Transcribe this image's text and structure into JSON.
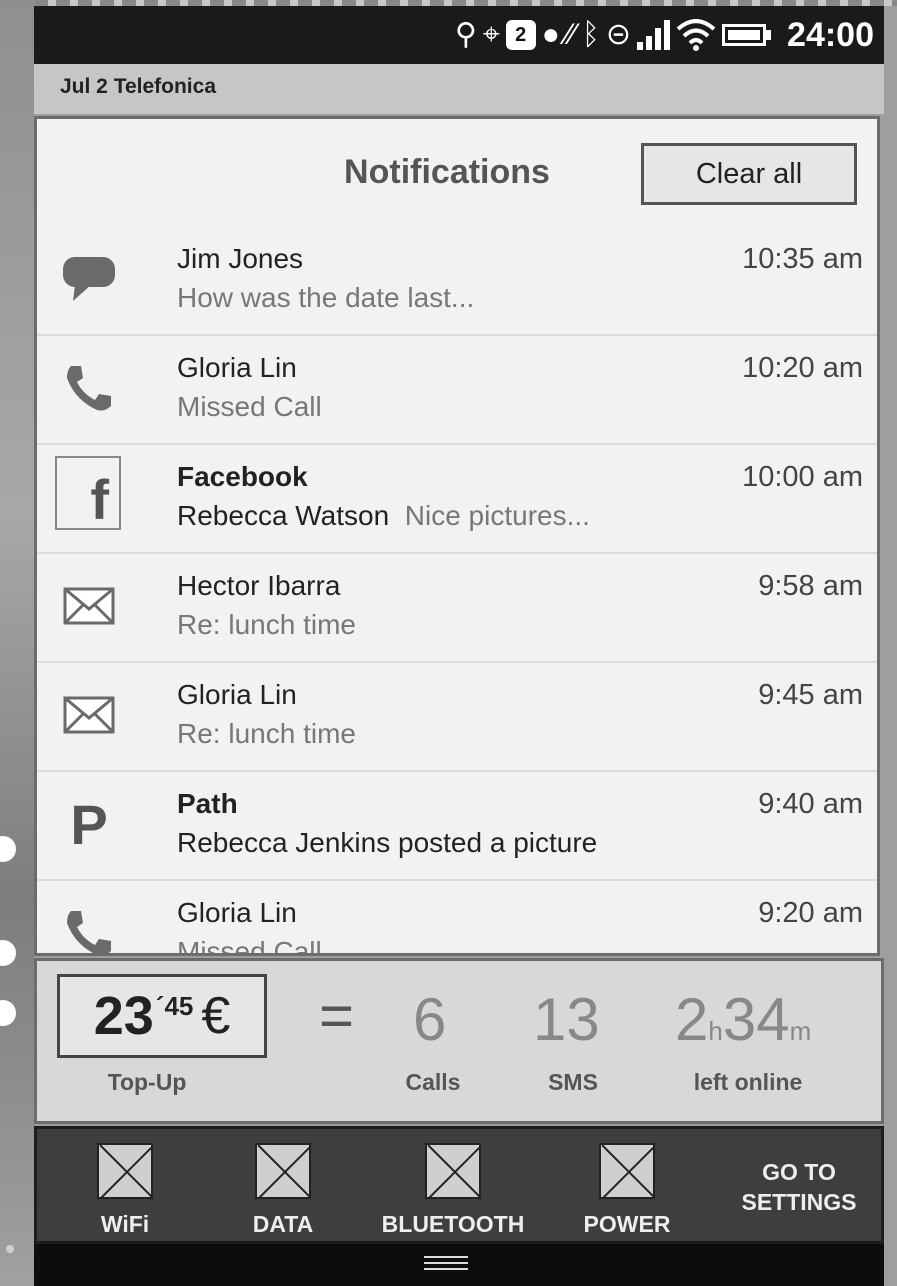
{
  "status_bar": {
    "icons": [
      "usb-icon",
      "location-target-icon",
      "chat-badge-icon",
      "dot-icon",
      "muted-icon",
      "bluetooth-icon",
      "link-icon",
      "signal-bars-icon",
      "wifi-icon",
      "battery-icon"
    ],
    "badge_count": "2",
    "time": "24:00"
  },
  "carrier_bar": {
    "text": "Jul 2  Telefonica"
  },
  "panel": {
    "title": "Notifications",
    "clear_label": "Clear all"
  },
  "notifications": [
    {
      "icon": "speech-bubble-icon",
      "name": "Jim Jones",
      "bold": false,
      "message": "How was the date last...",
      "time": "10:35 am"
    },
    {
      "icon": "phone-icon",
      "name": "Gloria Lin",
      "bold": false,
      "message": "Missed Call",
      "time": "10:20 am"
    },
    {
      "icon": "facebook-icon",
      "name": "Facebook",
      "bold": true,
      "sender": "Rebecca Watson",
      "message": "Nice pictures...",
      "time": "10:00 am"
    },
    {
      "icon": "envelope-icon",
      "name": "Hector Ibarra",
      "bold": false,
      "message": "Re: lunch time",
      "time": "9:58 am"
    },
    {
      "icon": "envelope-icon",
      "name": "Gloria Lin",
      "bold": false,
      "message": "Re: lunch time",
      "time": "9:45 am"
    },
    {
      "icon": "path-icon",
      "name": "Path",
      "bold": true,
      "message": "Rebecca Jenkins posted a picture",
      "time": "9:40 am"
    },
    {
      "icon": "phone-icon",
      "name": "Gloria Lin",
      "bold": false,
      "message": "Missed Call",
      "time": "9:20 am"
    }
  ],
  "icon_glyphs": {
    "facebook": "f",
    "path": "P"
  },
  "topup": {
    "amount_int": "23",
    "amount_dec": "´45",
    "currency": "€",
    "equals": "=",
    "calls": "6",
    "sms": "13",
    "hours": "2",
    "hours_unit": "h",
    "minutes": "34",
    "minutes_unit": "m",
    "labels": {
      "topup": "Top-Up",
      "calls": "Calls",
      "sms": "SMS",
      "online": "left online"
    }
  },
  "toggles": [
    {
      "label": "WiFi"
    },
    {
      "label": "DATA"
    },
    {
      "label": "BLUETOOTH"
    },
    {
      "label": "POWER"
    }
  ],
  "settings": {
    "line1": "GO TO",
    "line2": "SETTINGS"
  }
}
